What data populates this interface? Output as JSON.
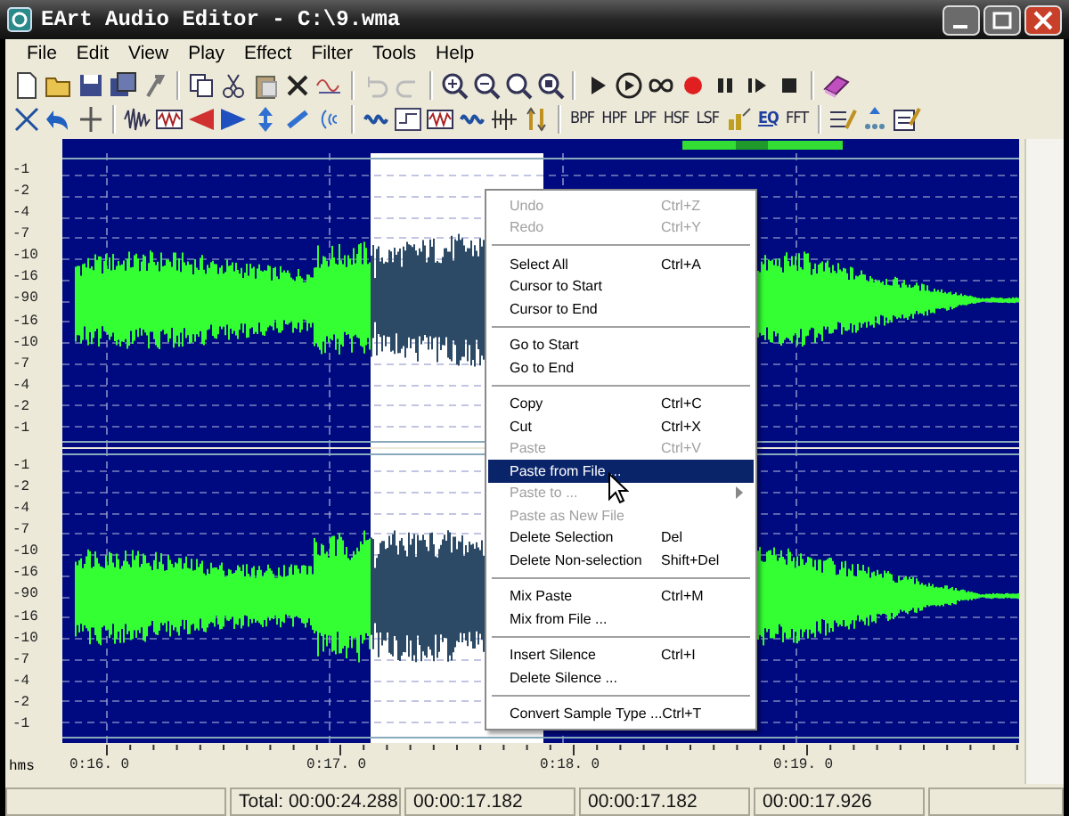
{
  "window": {
    "title": "EArt Audio Editor - C:\\9.wma"
  },
  "menu_bar": [
    "File",
    "Edit",
    "View",
    "Play",
    "Effect",
    "Filter",
    "Tools",
    "Help"
  ],
  "filter_buttons": [
    "BPF",
    "HPF",
    "LPF",
    "HSF",
    "LSF"
  ],
  "eq_button": "EQ",
  "fft_button": "FFT",
  "channels": [
    {
      "scale": [
        "-1",
        "-2",
        "-4",
        "-7",
        "-10",
        "-16",
        "-90",
        "-16",
        "-10",
        "-7",
        "-4",
        "-2",
        "-1"
      ]
    },
    {
      "scale": [
        "-1",
        "-2",
        "-4",
        "-7",
        "-10",
        "-16",
        "-90",
        "-16",
        "-10",
        "-7",
        "-4",
        "-2",
        "-1"
      ]
    }
  ],
  "time_ruler": {
    "unit": "hms",
    "labels": [
      "0:16. 0",
      "0:17. 0",
      "0:18. 0",
      "0:19. 0"
    ]
  },
  "context_menu": [
    {
      "kind": "item",
      "label": "Undo",
      "shortcut": "Ctrl+Z",
      "disabled": true,
      "selected": false,
      "submenu": false
    },
    {
      "kind": "item",
      "label": "Redo",
      "shortcut": "Ctrl+Y",
      "disabled": true,
      "selected": false,
      "submenu": false
    },
    {
      "kind": "separator"
    },
    {
      "kind": "item",
      "label": "Select All",
      "shortcut": "Ctrl+A",
      "disabled": false,
      "selected": false,
      "submenu": false
    },
    {
      "kind": "item",
      "label": "Cursor to Start",
      "disabled": false,
      "selected": false,
      "submenu": false
    },
    {
      "kind": "item",
      "label": "Cursor to End",
      "disabled": false,
      "selected": false,
      "submenu": false
    },
    {
      "kind": "separator"
    },
    {
      "kind": "item",
      "label": "Go to Start",
      "disabled": false,
      "selected": false,
      "submenu": false
    },
    {
      "kind": "item",
      "label": "Go to End",
      "disabled": false,
      "selected": false,
      "submenu": false
    },
    {
      "kind": "separator"
    },
    {
      "kind": "item",
      "label": "Copy",
      "shortcut": "Ctrl+C",
      "disabled": false,
      "selected": false,
      "submenu": false
    },
    {
      "kind": "item",
      "label": "Cut",
      "shortcut": "Ctrl+X",
      "disabled": false,
      "selected": false,
      "submenu": false
    },
    {
      "kind": "item",
      "label": "Paste",
      "shortcut": "Ctrl+V",
      "disabled": true,
      "selected": false,
      "submenu": false
    },
    {
      "kind": "item",
      "label": "Paste from File ...",
      "disabled": false,
      "selected": true,
      "submenu": false
    },
    {
      "kind": "item",
      "label": "Paste to ...",
      "disabled": true,
      "selected": false,
      "submenu": true
    },
    {
      "kind": "item",
      "label": "Paste as New File",
      "disabled": true,
      "selected": false,
      "submenu": false
    },
    {
      "kind": "item",
      "label": "Delete Selection",
      "shortcut": "Del",
      "disabled": false,
      "selected": false,
      "submenu": false
    },
    {
      "kind": "item",
      "label": "Delete Non-selection",
      "shortcut": "Shift+Del",
      "disabled": false,
      "selected": false,
      "submenu": false
    },
    {
      "kind": "separator"
    },
    {
      "kind": "item",
      "label": "Mix Paste",
      "shortcut": "Ctrl+M",
      "disabled": false,
      "selected": false,
      "submenu": false
    },
    {
      "kind": "item",
      "label": "Mix from File ...",
      "disabled": false,
      "selected": false,
      "submenu": false
    },
    {
      "kind": "separator"
    },
    {
      "kind": "item",
      "label": "Insert Silence",
      "shortcut": "Ctrl+I",
      "disabled": false,
      "selected": false,
      "submenu": false
    },
    {
      "kind": "item",
      "label": "Delete Silence ...",
      "disabled": false,
      "selected": false,
      "submenu": false
    },
    {
      "kind": "separator"
    },
    {
      "kind": "item",
      "label": "Convert Sample Type ...",
      "shortcut": "Ctrl+T",
      "disabled": false,
      "selected": false,
      "submenu": false
    }
  ],
  "status_bar": [
    "Total: 00:00:24.288",
    "00:00:17.182",
    "00:00:17.182",
    "00:00:17.926"
  ]
}
